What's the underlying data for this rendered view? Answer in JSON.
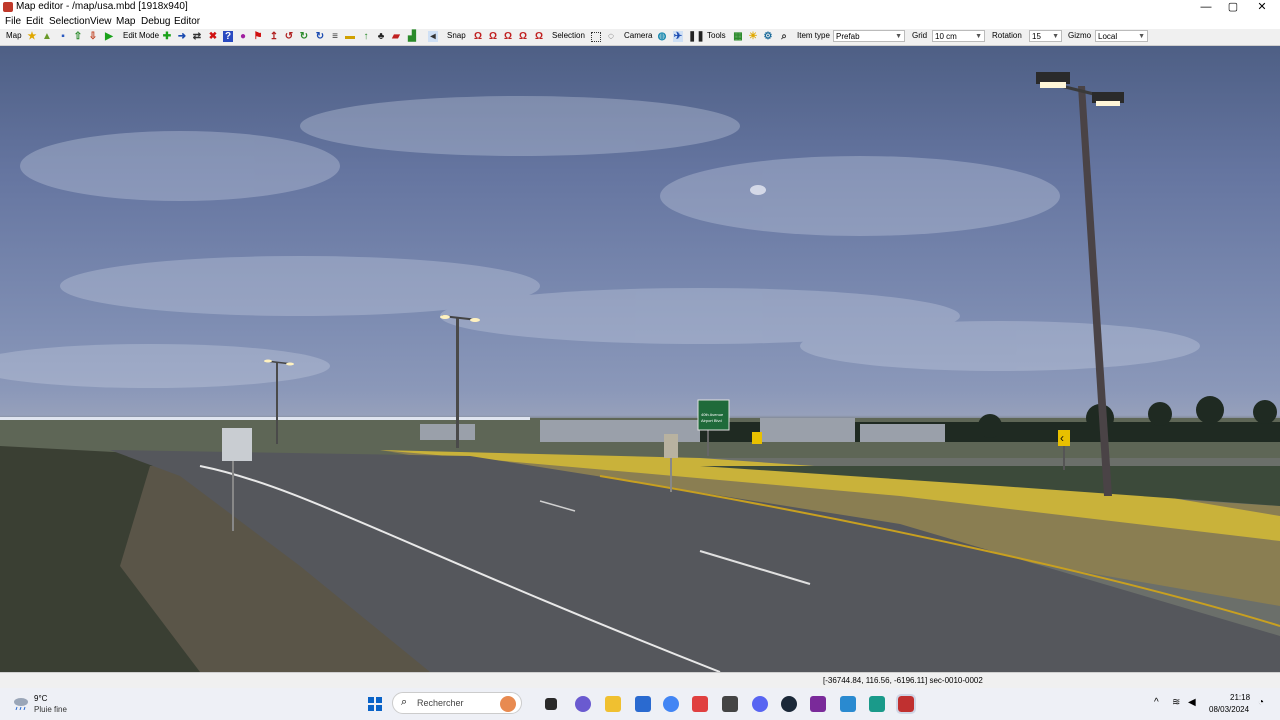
{
  "window": {
    "title": "Map editor - /map/usa.mbd [1918x940]",
    "controls": {
      "minimize": "—",
      "maximize": "▢",
      "close": "✕"
    }
  },
  "menubar": {
    "items": [
      "File",
      "Edit",
      "Selection",
      "View",
      "Map",
      "Debug",
      "Editor"
    ]
  },
  "toolbar": {
    "map_label": "Map",
    "edit_mode_label": "Edit Mode",
    "snap_label": "Snap",
    "selection_label": "Selection",
    "camera_label": "Camera",
    "tools_label": "Tools",
    "item_type_label": "Item type",
    "item_type_value": "Prefab",
    "grid_label": "Grid",
    "grid_value": "10 cm",
    "rotation_label": "Rotation",
    "rotation_value": "15",
    "gizmo_label": "Gizmo",
    "gizmo_value": "Local"
  },
  "viewport": {
    "sign_text": [
      "40th Avenue",
      "Airport Blvd"
    ]
  },
  "statusbar": {
    "coords": "[-36744.84, 116.56, -6196.11] sec-0010-0002"
  },
  "taskbar": {
    "weather_temp": "9°C",
    "weather_condition": "Pluie fine",
    "search_placeholder": "Rechercher",
    "time": "21:18",
    "date": "08/03/2024"
  },
  "colors": {
    "accent": "#0a63c8",
    "sky": "#6575a0",
    "grass_lit": "#c9b23a"
  }
}
